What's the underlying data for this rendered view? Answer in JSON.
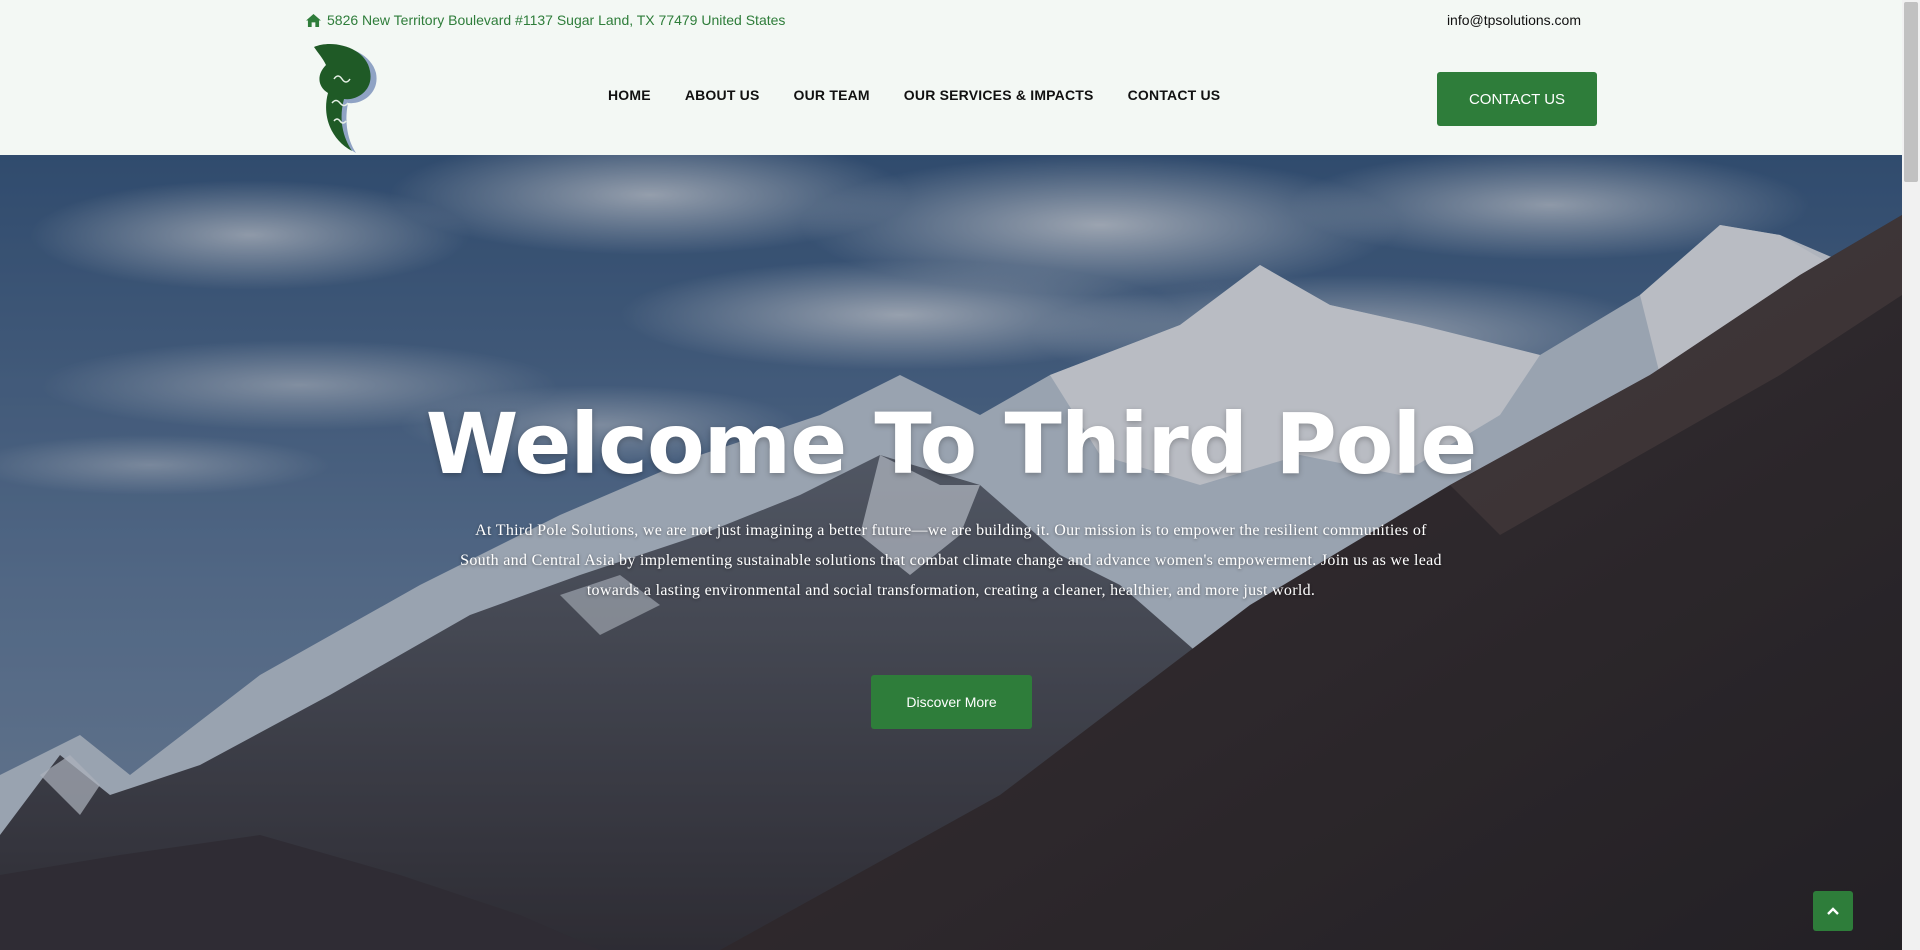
{
  "topbar": {
    "address": "5826 New Territory Boulevard #1137 Sugar Land, TX 77479 United States",
    "address_icon": "home-icon",
    "email": "info@tpsolutions.com"
  },
  "header": {
    "logo_icon": "third-pole-logo",
    "nav": [
      {
        "label": "HOME"
      },
      {
        "label": "ABOUT US"
      },
      {
        "label": "OUR TEAM"
      },
      {
        "label": "OUR SERVICES & IMPACTS"
      },
      {
        "label": "CONTACT US"
      }
    ],
    "cta_label": "CONTACT US"
  },
  "hero": {
    "title": "Welcome To Third Pole",
    "text": "At Third Pole Solutions, we are not just imagining a better future—we are building it. Our mission is to empower the resilient communities of South and Central Asia by implementing sustainable solutions that combat climate change and advance women's empowerment. Join us as we lead towards a lasting environmental and social transformation, creating a cleaner, healthier, and more just world.",
    "button_label": "Discover More",
    "background": "mountain-landscape-image"
  },
  "back_to_top_icon": "chevron-up-icon",
  "colors": {
    "brand_green": "#2e7d3a",
    "header_bg": "#f3f8f4",
    "text_dark": "#111111"
  }
}
